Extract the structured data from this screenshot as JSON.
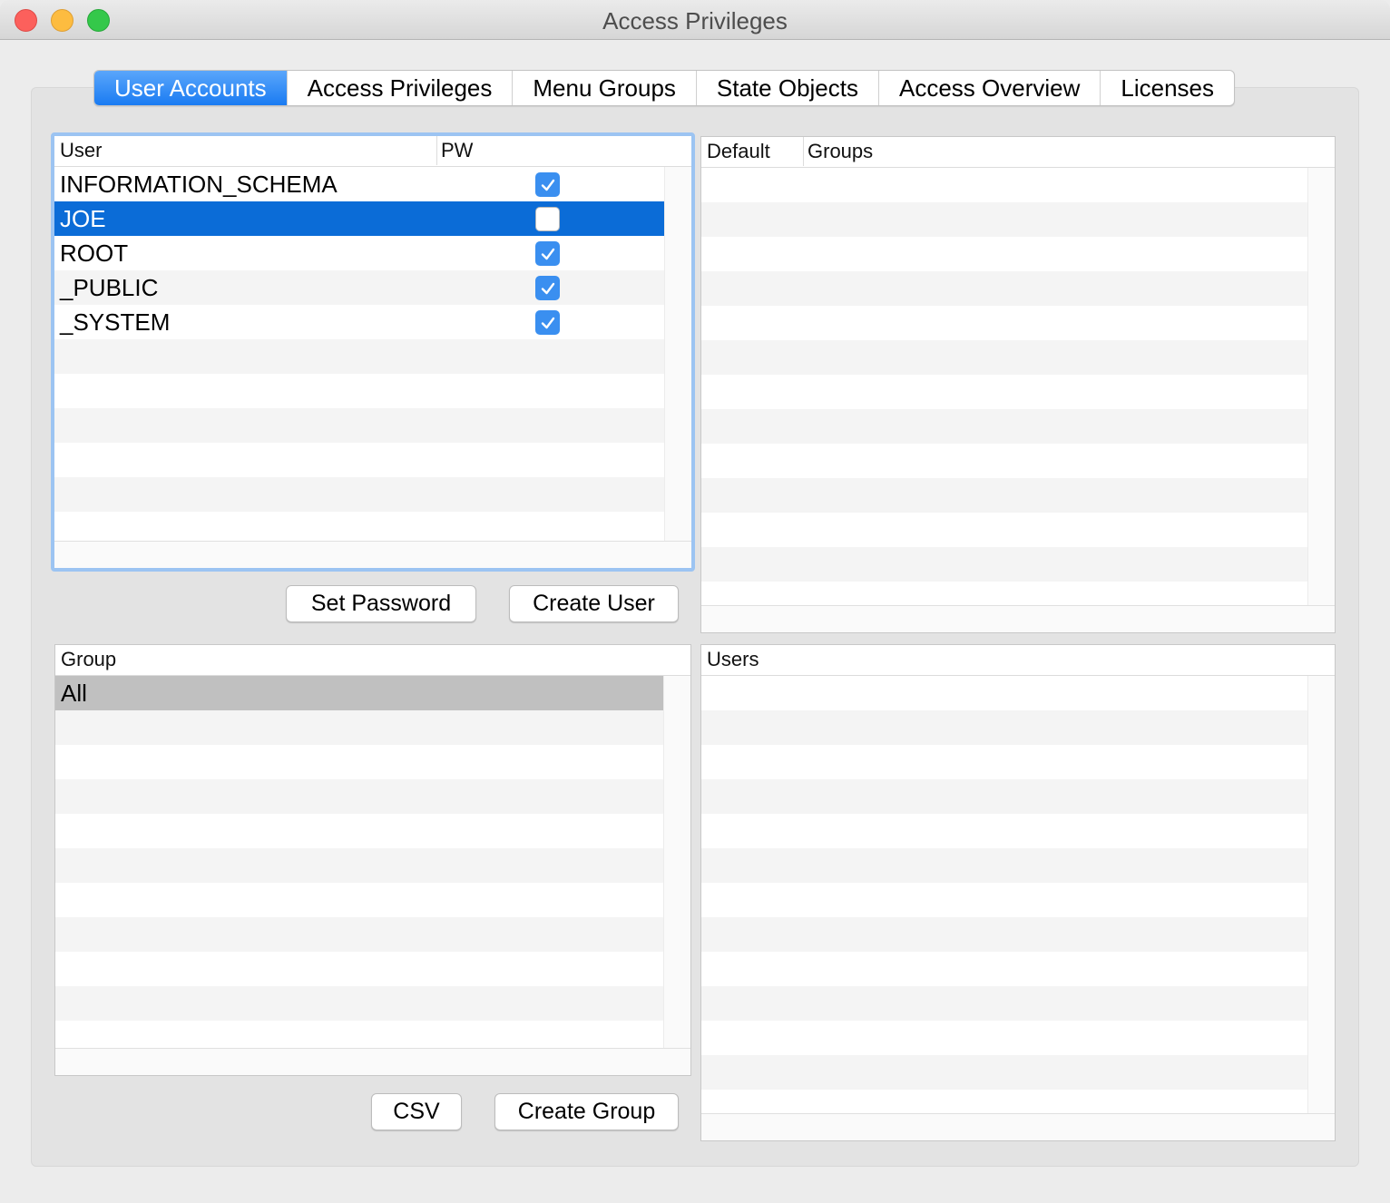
{
  "window": {
    "title": "Access Privileges"
  },
  "tabs": [
    {
      "label": "User Accounts",
      "active": true
    },
    {
      "label": "Access Privileges"
    },
    {
      "label": "Menu Groups"
    },
    {
      "label": "State Objects"
    },
    {
      "label": "Access Overview"
    },
    {
      "label": "Licenses"
    }
  ],
  "users_table": {
    "col_user": "User",
    "col_pw": "PW",
    "rows": [
      {
        "name": "INFORMATION_SCHEMA",
        "pw": true
      },
      {
        "name": "JOE",
        "pw": false,
        "selected": true
      },
      {
        "name": "ROOT",
        "pw": true
      },
      {
        "name": "_PUBLIC",
        "pw": true
      },
      {
        "name": "_SYSTEM",
        "pw": true
      }
    ]
  },
  "default_groups_table": {
    "col_default": "Default",
    "col_groups": "Groups"
  },
  "groups_table": {
    "col_group": "Group",
    "rows": [
      {
        "name": "All",
        "selected": true
      }
    ]
  },
  "group_users_table": {
    "col_users": "Users"
  },
  "buttons": {
    "set_password": "Set Password",
    "create_user": "Create User",
    "csv": "CSV",
    "create_group": "Create Group"
  },
  "colors": {
    "accent": "#1a7bf2",
    "selection": "#0b6cd7",
    "inactive_selection": "#c0c0c0",
    "checkbox": "#3a8ff0"
  },
  "icons": [
    "close-button-icon",
    "minimize-button-icon",
    "zoom-button-icon",
    "checkmark-icon"
  ]
}
